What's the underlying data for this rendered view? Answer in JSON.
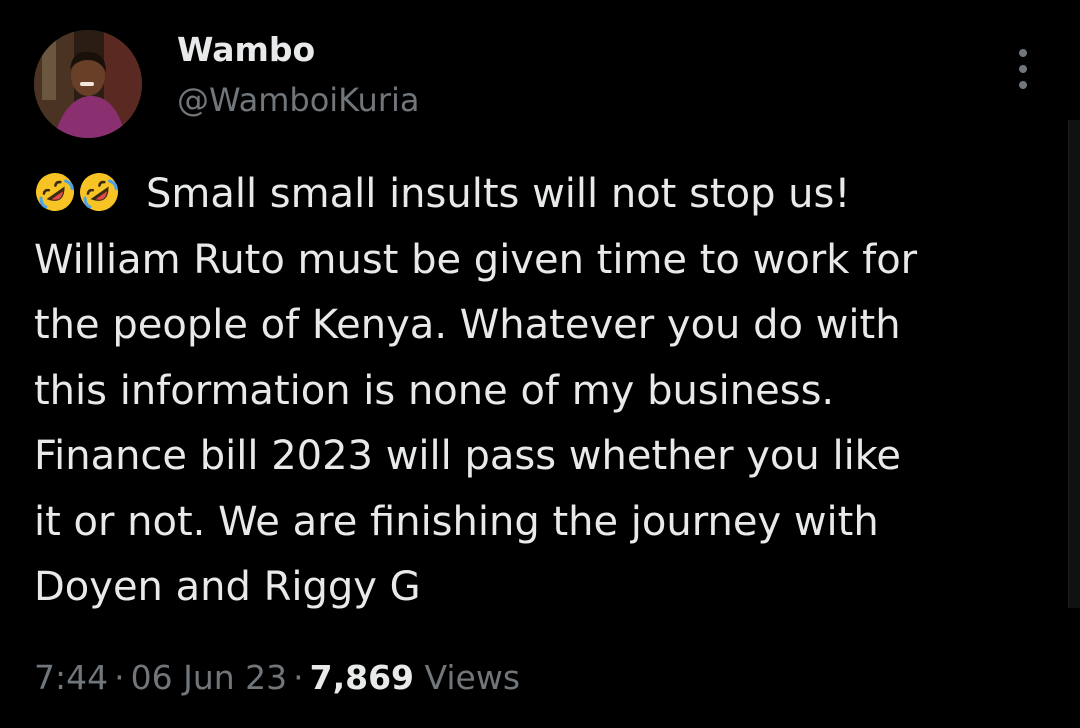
{
  "tweet": {
    "author": {
      "display_name": "Wambo",
      "handle": "@WamboiKuria"
    },
    "emojis": [
      "rolling-on-floor-laughing",
      "rolling-on-floor-laughing"
    ],
    "text_lines": [
      "Small small insults will not stop us!",
      "William Ruto must be given time to work for",
      "the people of Kenya. Whatever you do with",
      "this information is none of my business.",
      "Finance bill 2023 will pass whether you like",
      "it or not. We are finishing the journey with",
      "Doyen and Riggy G"
    ],
    "time": "7:44",
    "separator": "·",
    "date": "06 Jun 23",
    "views_count": "7,869",
    "views_label": "Views"
  },
  "icons": {
    "more": "more-vertical-icon"
  },
  "colors": {
    "background": "#000000",
    "primary_text": "#e7e9ea",
    "secondary_text": "#71767b",
    "emoji_face": "#f7c325"
  }
}
